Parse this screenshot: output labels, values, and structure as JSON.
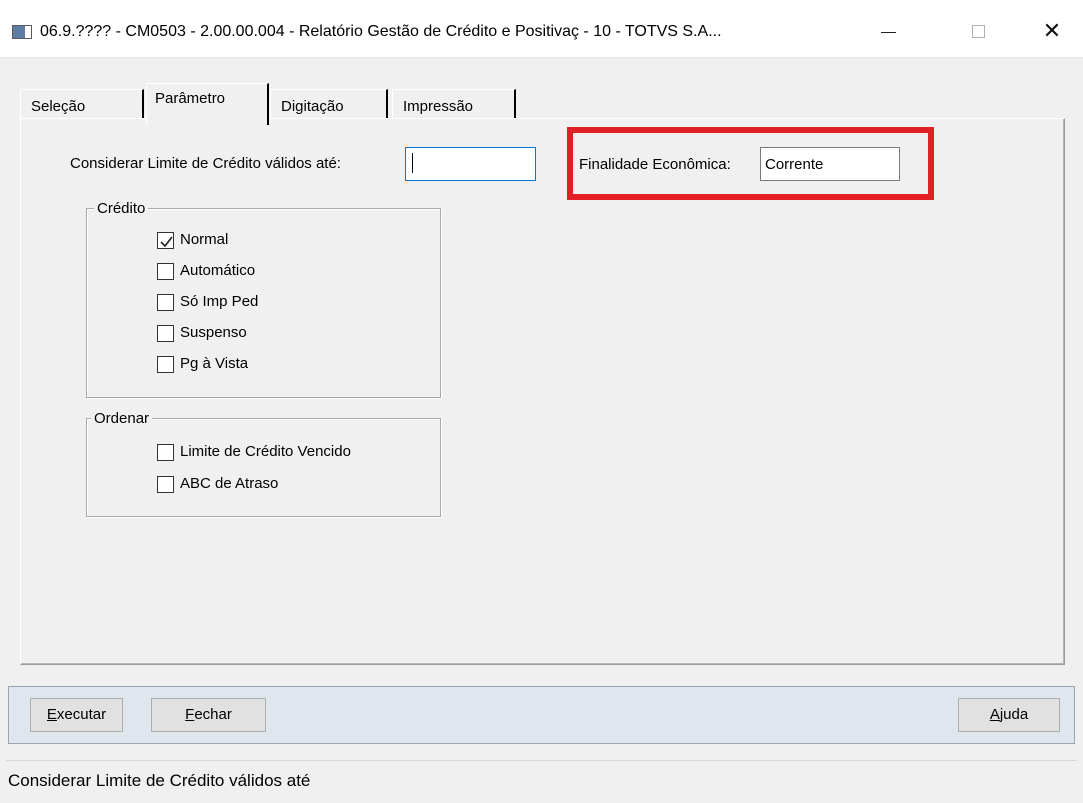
{
  "window": {
    "title": "06.9.???? - CM0503 - 2.00.00.004 - Relatório Gestão de Crédito e Positivaç - 10 - TOTVS S.A...",
    "minimize_glyph": "",
    "maximize_glyph": "",
    "close_glyph": "✕"
  },
  "tabs": [
    {
      "label": "Seleção",
      "active": false
    },
    {
      "label": "Parâmetro",
      "active": true
    },
    {
      "label": "Digitação",
      "active": false
    },
    {
      "label": "Impressão",
      "active": false
    }
  ],
  "parametros": {
    "limite_label": "Considerar Limite de Crédito válidos até:",
    "limite_value": "",
    "finalidade_label": "Finalidade Econômica:",
    "finalidade_value": "Corrente"
  },
  "credito": {
    "legend": "Crédito",
    "items": [
      {
        "label": "Normal",
        "checked": true
      },
      {
        "label": "Automático",
        "checked": false
      },
      {
        "label": "Só Imp Ped",
        "checked": false
      },
      {
        "label": "Suspenso",
        "checked": false
      },
      {
        "label": "Pg à Vista",
        "checked": false
      }
    ]
  },
  "ordenar": {
    "legend": "Ordenar",
    "items": [
      {
        "label": "Limite de Crédito Vencido",
        "checked": false
      },
      {
        "label": "ABC de Atraso",
        "checked": false
      }
    ]
  },
  "buttons": {
    "executar_mnemonic": "E",
    "executar_rest": "xecutar",
    "fechar_mnemonic": "F",
    "fechar_rest": "echar",
    "ajuda_mnemonic": "A",
    "ajuda_rest": "juda"
  },
  "status_text": "Considerar Limite de Crédito válidos até",
  "colors": {
    "highlight": "#e21f26",
    "focus": "#0078d7",
    "bottom_bar": "#dfe6ee"
  }
}
